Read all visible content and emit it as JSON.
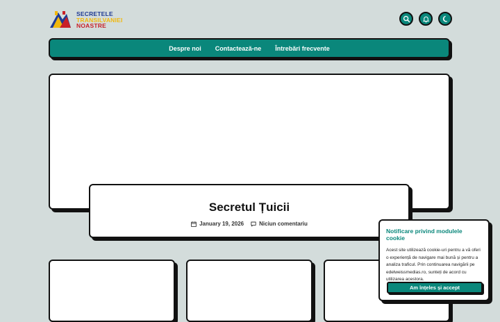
{
  "brand": {
    "line1": "SECRETELE",
    "line2": "TRANSILVANIEI",
    "line3": "NOASTRE"
  },
  "header_icons": [
    "search-icon",
    "bell-icon",
    "moon-icon"
  ],
  "nav": {
    "items": [
      {
        "label": "Despre noi"
      },
      {
        "label": "Contactează-ne"
      },
      {
        "label": "Întrebări frecvente"
      }
    ]
  },
  "post": {
    "title": "Secretul Țuicii",
    "date": "January 19, 2026",
    "comments": "Niciun comentariu"
  },
  "cookie": {
    "title": "Notificare privind modulele cookie",
    "text": "Acest site utilizează cookie-uri pentru a vă oferi o experiență de navigare mai bună și pentru a analiza traficul. Prin continuarea navigării pe edelweissmedias.ro, sunteți de acord cu utilizarea acestora.",
    "button": "Am înțeles și accept"
  },
  "colors": {
    "background": "#d3dcdb",
    "accent": "#0a877b",
    "border": "#111111"
  }
}
